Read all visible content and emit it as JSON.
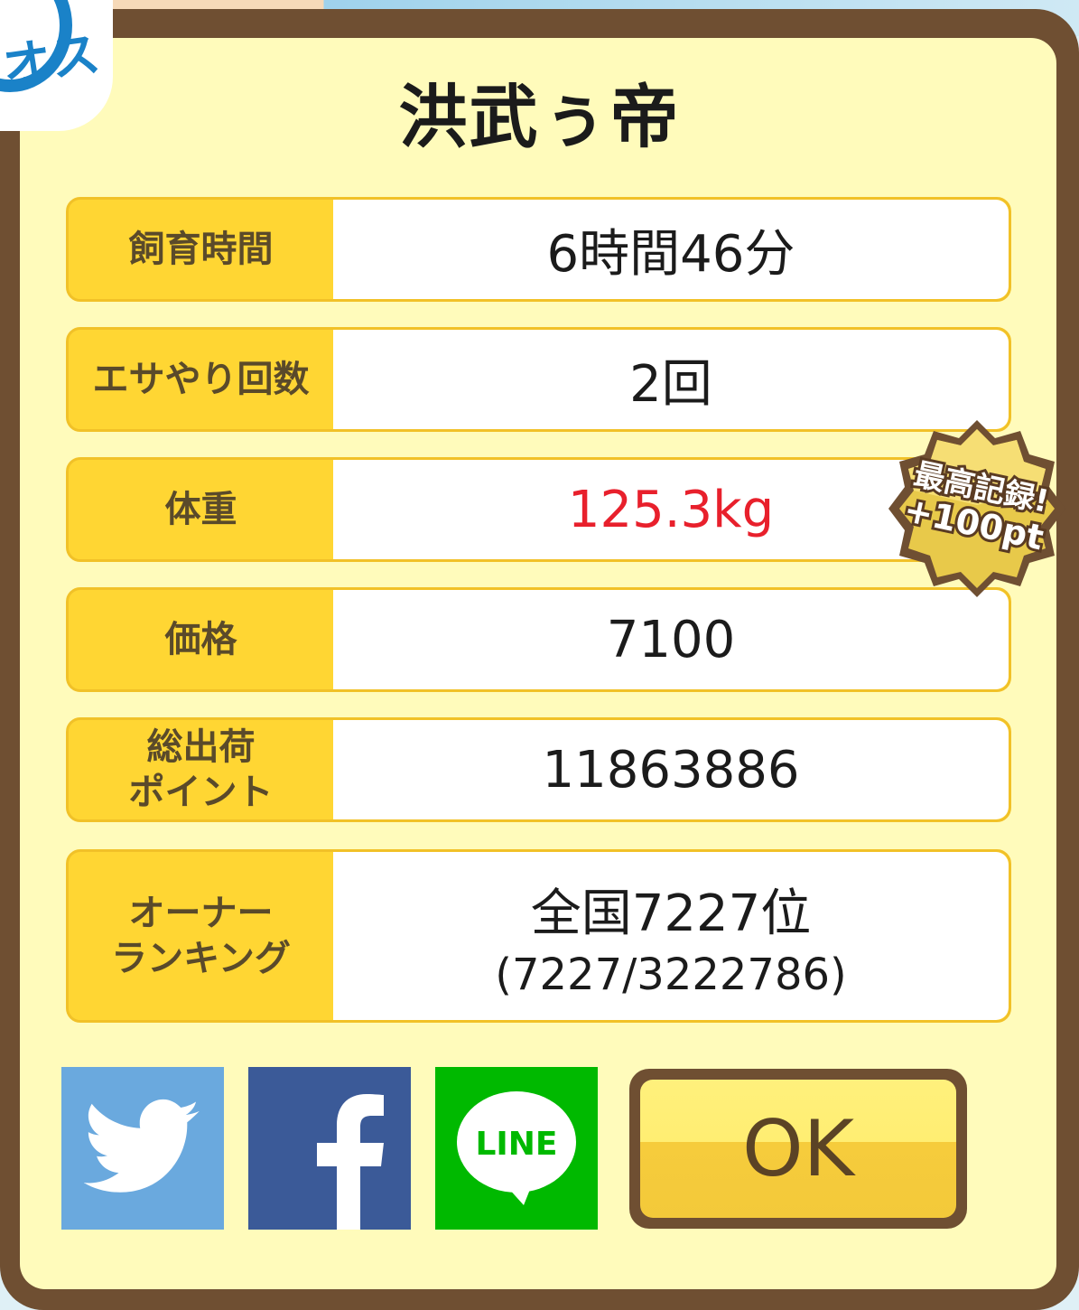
{
  "dialog": {
    "title": "洪武ぅ帝",
    "corner_badge_text": "オス",
    "rows": [
      {
        "label": "飼育時間",
        "value": "6時間46分"
      },
      {
        "label": "エサやり回数",
        "value": "2回"
      },
      {
        "label": "体重",
        "value": "125.3kg",
        "value_color": "#e8202c"
      },
      {
        "label": "価格",
        "value": "7100"
      },
      {
        "label_line1": "総出荷",
        "label_line2": "ポイント",
        "value": "11863886"
      },
      {
        "label_line1": "オーナー",
        "label_line2": "ランキング",
        "value": "全国7227位",
        "value_sub": "(7227/3222786)"
      }
    ],
    "record_stamp": {
      "line1": "最高記録!",
      "line2": "+100pt"
    },
    "share": {
      "twitter_icon": "twitter-bird-icon",
      "facebook_icon": "facebook-f-icon",
      "line_icon": "line-chat-icon",
      "line_text": "LINE"
    },
    "ok_label": "OK"
  },
  "colors": {
    "frame": "#6f4f32",
    "panel": "#fffbbb",
    "label_bg": "#ffd633",
    "twitter": "#6aa9de",
    "facebook": "#3b5a98",
    "line": "#00b900",
    "record_red": "#e8202c"
  }
}
